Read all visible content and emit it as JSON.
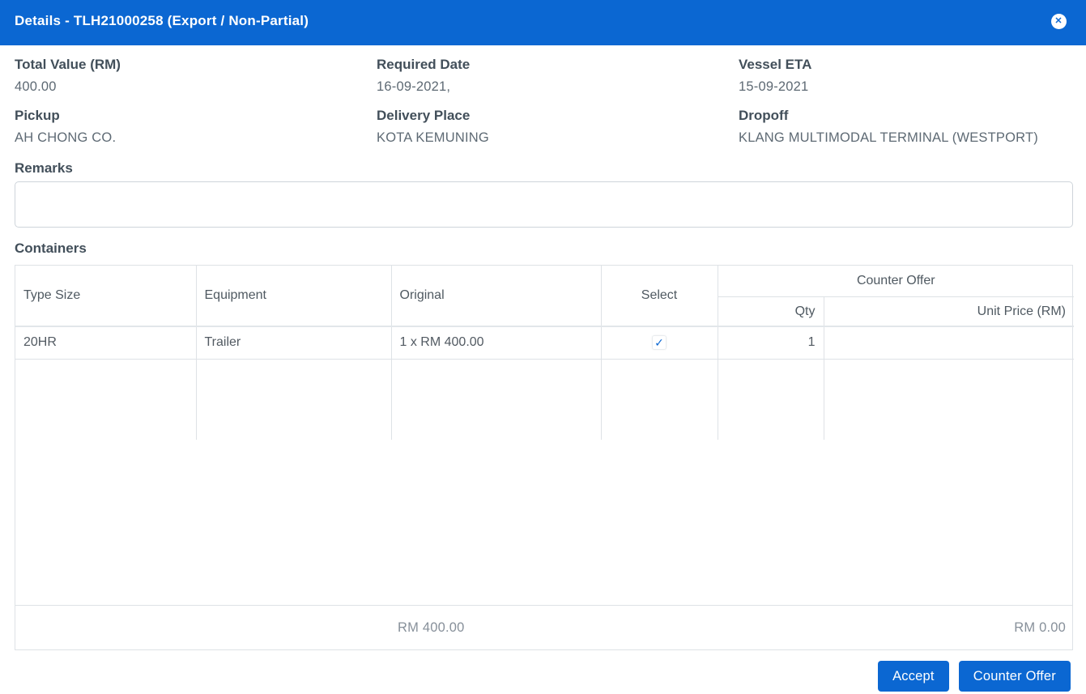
{
  "modal": {
    "title": "Details - TLH21000258 (Export / Non-Partial)"
  },
  "icons": {
    "close_glyph": "✕",
    "check_glyph": "✓"
  },
  "colors": {
    "primary": "#0b67d2",
    "border": "#dee2e6",
    "label_text": "#424f5a",
    "value_text": "#5e6a74",
    "muted_text": "#87909a"
  },
  "info": {
    "fields": [
      {
        "label": "Total Value (RM)",
        "value": "400.00"
      },
      {
        "label": "Required Date",
        "value": "16-09-2021,"
      },
      {
        "label": "Vessel ETA",
        "value": "15-09-2021"
      },
      {
        "label": "Pickup",
        "value": "AH CHONG CO."
      },
      {
        "label": "Delivery Place",
        "value": "KOTA KEMUNING"
      },
      {
        "label": "Dropoff",
        "value": "KLANG MULTIMODAL TERMINAL (WESTPORT)"
      }
    ]
  },
  "remarks": {
    "label": "Remarks",
    "value": "",
    "placeholder": ""
  },
  "containers": {
    "heading": "Containers",
    "columns": {
      "type_size": "Type Size",
      "equipment": "Equipment",
      "original": "Original",
      "select": "Select",
      "counter_offer": "Counter Offer",
      "qty": "Qty",
      "unit_price": "Unit Price (RM)"
    },
    "rows": [
      {
        "type_size": "20HR",
        "equipment": "Trailer",
        "original": "1 x RM 400.00",
        "selected": true,
        "qty": "1",
        "unit_price": ""
      }
    ],
    "totals": {
      "original_total": "RM 400.00",
      "counter_total": "RM 0.00"
    }
  },
  "actions": {
    "accept_label": "Accept",
    "counter_offer_label": "Counter Offer"
  }
}
